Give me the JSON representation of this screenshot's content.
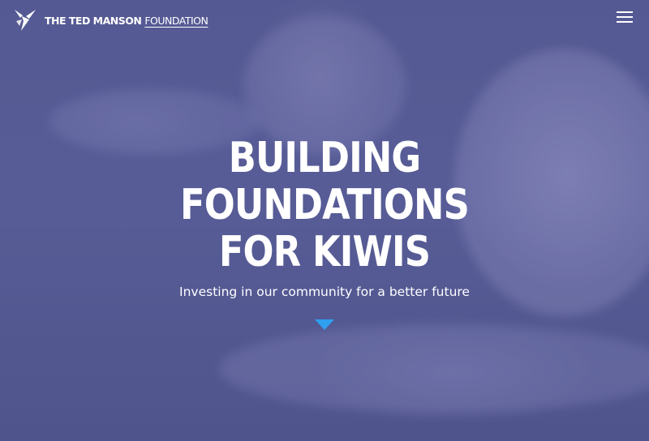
{
  "brand": {
    "name_main": "THE TED MANSON",
    "name_accent": "FOUNDATION",
    "logo_icon": "bird-logo-icon"
  },
  "nav": {
    "menu_icon": "hamburger-menu-icon"
  },
  "hero": {
    "headline_lines": [
      "BUILDING",
      "FOUNDATIONS",
      "FOR KIWIS"
    ],
    "tagline": "Investing in our community for a better future",
    "scroll_icon": "triangle-down-icon"
  },
  "colors": {
    "overlay": "#575d96",
    "text": "#ffffff",
    "accent": "#2f9ff0"
  }
}
